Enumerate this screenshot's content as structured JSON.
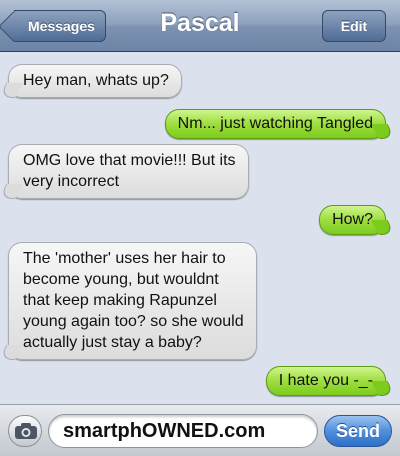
{
  "navbar": {
    "back_label": "Messages",
    "title": "Pascal",
    "edit_label": "Edit"
  },
  "messages": [
    {
      "direction": "in",
      "text": "Hey man, whats up?"
    },
    {
      "direction": "out",
      "text": "Nm... just watching Tangled"
    },
    {
      "direction": "in",
      "text": "OMG love that movie!!! But its\nvery incorrect"
    },
    {
      "direction": "out",
      "text": "How?"
    },
    {
      "direction": "in",
      "text": "The 'mother' uses her hair to\nbecome young, but wouldnt\nthat keep making Rapunzel\nyoung again too? so she would\nactually just stay a baby?"
    },
    {
      "direction": "out",
      "text": "I hate you -_-"
    }
  ],
  "input": {
    "camera_icon": "camera-icon",
    "value": "smartphOWNED.com",
    "send_label": "Send"
  },
  "colors": {
    "outgoing_bubble": "#9ede3e",
    "incoming_bubble": "#e8e8e8",
    "navbar": "#8ca0bc",
    "send_button": "#4f8fdc",
    "background": "#dbe2ed"
  }
}
